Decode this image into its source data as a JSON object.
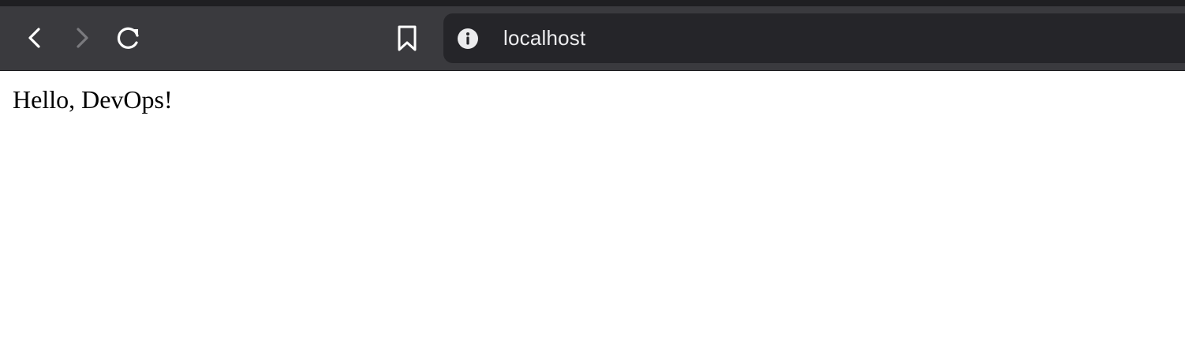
{
  "browser": {
    "toolbar": {
      "back_icon": "chevron-left-icon",
      "forward_icon": "chevron-right-icon",
      "reload_icon": "reload-icon",
      "bookmark_icon": "bookmark-icon"
    },
    "address_bar": {
      "site_info_icon": "info-icon",
      "url": "localhost"
    },
    "colors": {
      "toolbar_bg": "#3a3a3e",
      "address_bar_bg": "#252529",
      "icon_active": "#ffffff",
      "icon_disabled": "#7a7a7e"
    }
  },
  "page": {
    "body_text": "Hello, DevOps!"
  }
}
